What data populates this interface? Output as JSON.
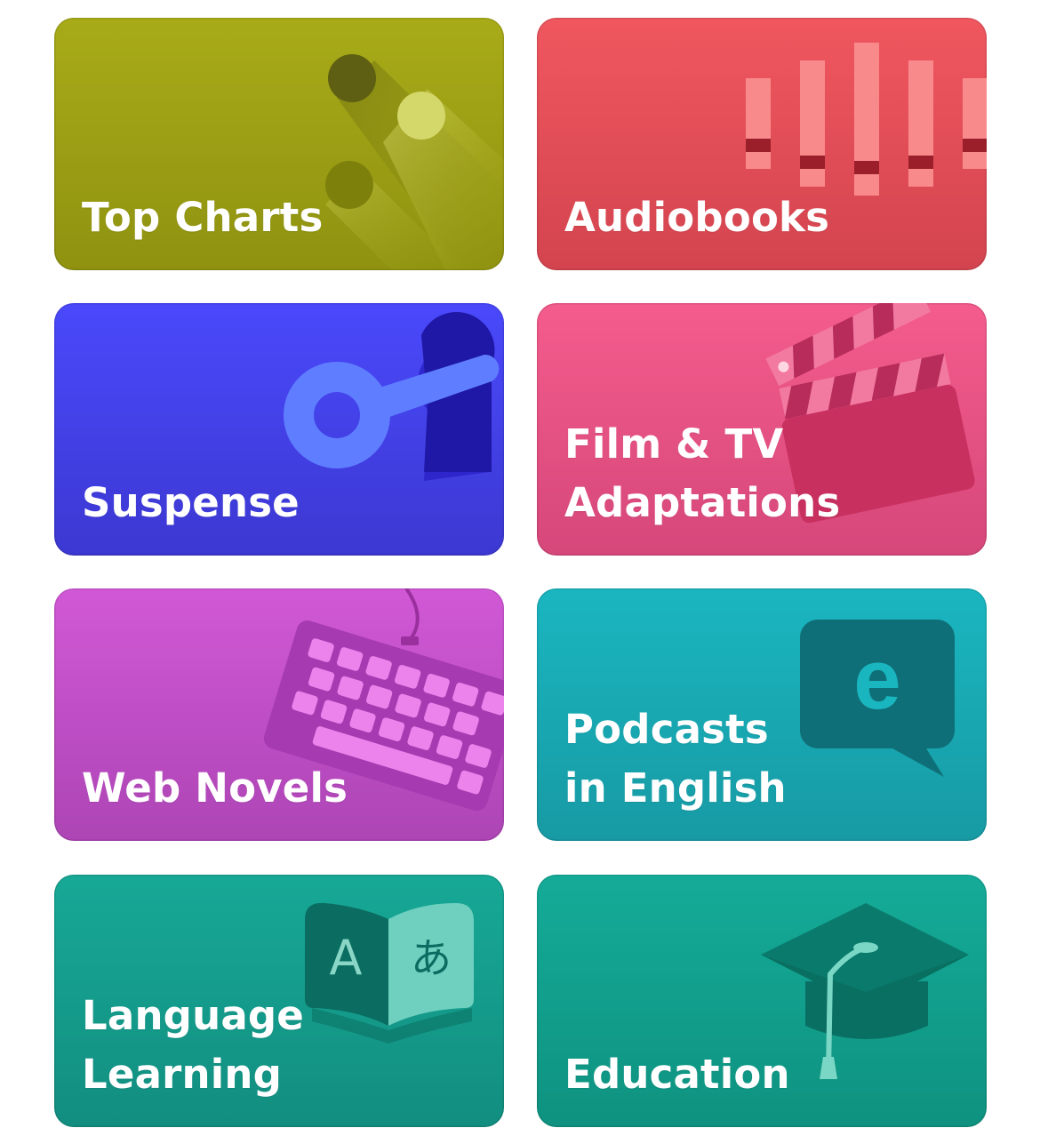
{
  "categories": [
    {
      "label": "Top Charts",
      "icon": "top-charts-icon",
      "color": "#a8ab18"
    },
    {
      "label": "Audiobooks",
      "icon": "audiobooks-icon",
      "color": "#f0575f"
    },
    {
      "label": "Suspense",
      "icon": "key-icon",
      "color": "#4a49fb"
    },
    {
      "label": "Film & TV\nAdaptations",
      "icon": "clapperboard-icon",
      "color": "#f45c8d"
    },
    {
      "label": "Web Novels",
      "icon": "keyboard-icon",
      "color": "#d158d6"
    },
    {
      "label": "Podcasts\nin English",
      "icon": "speech-bubble-icon",
      "color": "#1ab6c0"
    },
    {
      "label": "Language\nLearning",
      "icon": "open-book-icon",
      "color": "#17a896"
    },
    {
      "label": "Education",
      "icon": "graduation-cap-icon",
      "color": "#14ab98"
    }
  ],
  "icon_glyphs": {
    "speech_bubble_letter": "e",
    "book_left_letter": "A",
    "book_right_letter": "あ"
  }
}
